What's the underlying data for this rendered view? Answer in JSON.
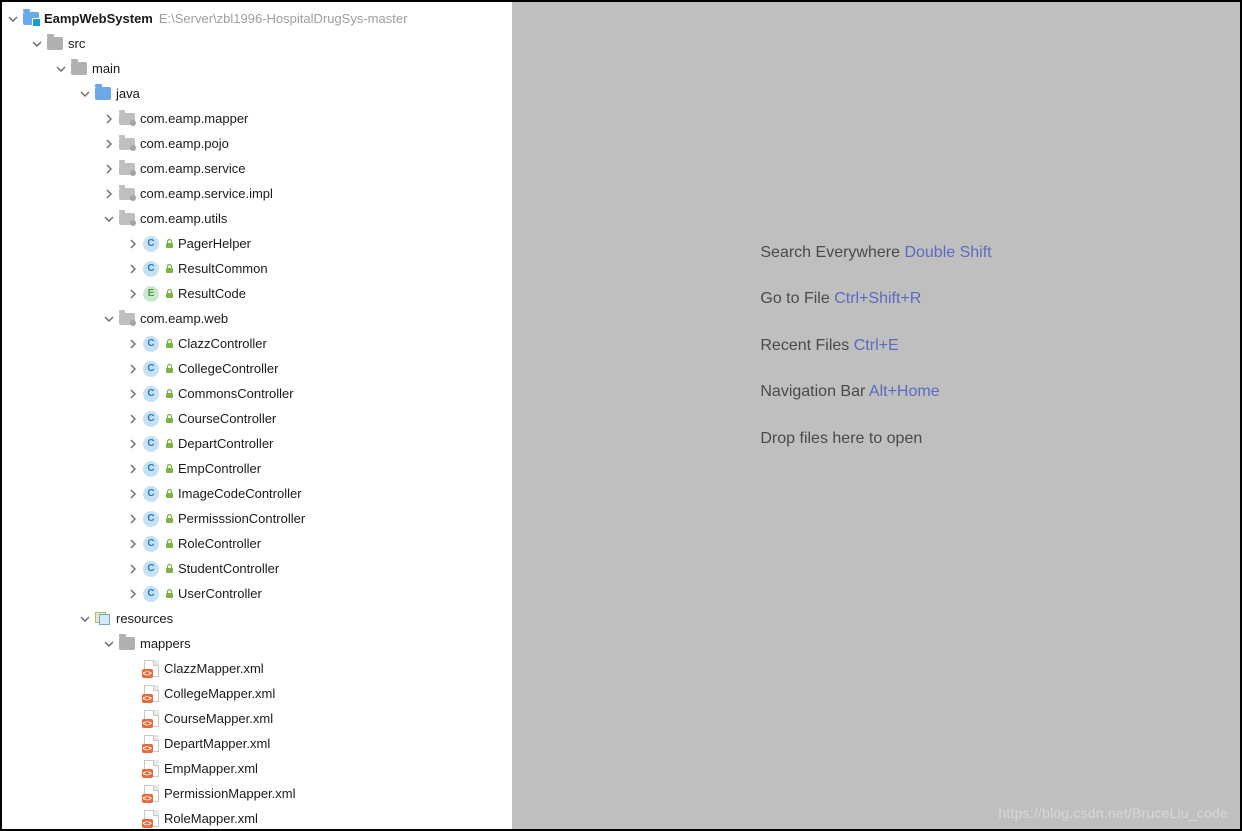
{
  "project": {
    "root": {
      "name": "EampWebSystem",
      "path": "E:\\Server\\zbl1996-HospitalDrugSys-master",
      "icon": "module"
    },
    "tree": [
      {
        "depth": 0,
        "chev": "down",
        "icon": "module",
        "label": "EampWebSystem",
        "bold": true,
        "path": "E:\\Server\\zbl1996-HospitalDrugSys-master"
      },
      {
        "depth": 1,
        "chev": "down",
        "icon": "folder",
        "label": "src"
      },
      {
        "depth": 2,
        "chev": "down",
        "icon": "folder",
        "label": "main"
      },
      {
        "depth": 3,
        "chev": "down",
        "icon": "folder-blue",
        "label": "java"
      },
      {
        "depth": 4,
        "chev": "right",
        "icon": "package-dir",
        "label": "com.eamp.mapper"
      },
      {
        "depth": 4,
        "chev": "right",
        "icon": "package-dir",
        "label": "com.eamp.pojo"
      },
      {
        "depth": 4,
        "chev": "right",
        "icon": "package-dir",
        "label": "com.eamp.service"
      },
      {
        "depth": 4,
        "chev": "right",
        "icon": "package-dir",
        "label": "com.eamp.service.impl"
      },
      {
        "depth": 4,
        "chev": "down",
        "icon": "package-dir",
        "label": "com.eamp.utils"
      },
      {
        "depth": 5,
        "chev": "right",
        "icon": "class",
        "lock": true,
        "label": "PagerHelper"
      },
      {
        "depth": 5,
        "chev": "right",
        "icon": "class",
        "lock": true,
        "label": "ResultCommon"
      },
      {
        "depth": 5,
        "chev": "right",
        "icon": "enum",
        "lock": true,
        "label": "ResultCode"
      },
      {
        "depth": 4,
        "chev": "down",
        "icon": "package-dir",
        "label": "com.eamp.web"
      },
      {
        "depth": 5,
        "chev": "right",
        "icon": "class",
        "lock": true,
        "label": "ClazzController"
      },
      {
        "depth": 5,
        "chev": "right",
        "icon": "class",
        "lock": true,
        "label": "CollegeController"
      },
      {
        "depth": 5,
        "chev": "right",
        "icon": "class",
        "lock": true,
        "label": "CommonsController"
      },
      {
        "depth": 5,
        "chev": "right",
        "icon": "class",
        "lock": true,
        "label": "CourseController"
      },
      {
        "depth": 5,
        "chev": "right",
        "icon": "class",
        "lock": true,
        "label": "DepartController"
      },
      {
        "depth": 5,
        "chev": "right",
        "icon": "class",
        "lock": true,
        "label": "EmpController"
      },
      {
        "depth": 5,
        "chev": "right",
        "icon": "class",
        "lock": true,
        "label": "ImageCodeController"
      },
      {
        "depth": 5,
        "chev": "right",
        "icon": "class",
        "lock": true,
        "label": "PermisssionController"
      },
      {
        "depth": 5,
        "chev": "right",
        "icon": "class",
        "lock": true,
        "label": "RoleController"
      },
      {
        "depth": 5,
        "chev": "right",
        "icon": "class",
        "lock": true,
        "label": "StudentController"
      },
      {
        "depth": 5,
        "chev": "right",
        "icon": "class",
        "lock": true,
        "label": "UserController"
      },
      {
        "depth": 3,
        "chev": "down",
        "icon": "resources",
        "label": "resources"
      },
      {
        "depth": 4,
        "chev": "down",
        "icon": "folder",
        "label": "mappers"
      },
      {
        "depth": 5,
        "chev": "none",
        "icon": "xml",
        "label": "ClazzMapper.xml"
      },
      {
        "depth": 5,
        "chev": "none",
        "icon": "xml",
        "label": "CollegeMapper.xml"
      },
      {
        "depth": 5,
        "chev": "none",
        "icon": "xml",
        "label": "CourseMapper.xml"
      },
      {
        "depth": 5,
        "chev": "none",
        "icon": "xml",
        "label": "DepartMapper.xml"
      },
      {
        "depth": 5,
        "chev": "none",
        "icon": "xml",
        "label": "EmpMapper.xml"
      },
      {
        "depth": 5,
        "chev": "none",
        "icon": "xml",
        "label": "PermissionMapper.xml"
      },
      {
        "depth": 5,
        "chev": "none",
        "icon": "xml",
        "label": "RoleMapper.xml"
      }
    ]
  },
  "editor": {
    "tips": [
      {
        "text": "Search Everywhere",
        "shortcut": "Double Shift"
      },
      {
        "text": "Go to File",
        "shortcut": "Ctrl+Shift+R"
      },
      {
        "text": "Recent Files",
        "shortcut": "Ctrl+E"
      },
      {
        "text": "Navigation Bar",
        "shortcut": "Alt+Home"
      },
      {
        "text": "Drop files here to open",
        "shortcut": ""
      }
    ]
  },
  "watermark": "https://blog.csdn.net/BruceLiu_code"
}
